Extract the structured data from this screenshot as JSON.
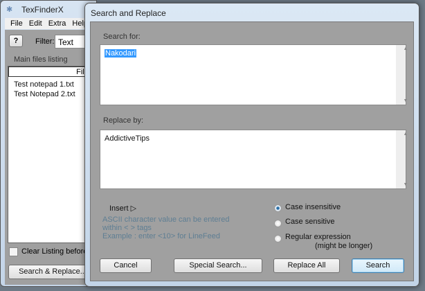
{
  "main_window": {
    "title": "TexFinderX",
    "menu": [
      "File",
      "Edit",
      "Extra",
      "Help"
    ],
    "help_button": "?",
    "filter_label": "Filter:",
    "filter_value": "Text",
    "listing_label": "Main files listing",
    "column_header": "File n",
    "files": [
      "Test notepad 1.txt",
      "Test Notepad 2.txt"
    ],
    "clear_listing_label": "Clear Listing before a",
    "clear_listing_checked": false,
    "search_replace_button": "Search & Replace..."
  },
  "dialog": {
    "title": "Search and Replace",
    "search_label": "Search for:",
    "search_value": "Nakodari",
    "replace_label": "Replace by:",
    "replace_value": "AddictiveTips",
    "insert_label": "Insert",
    "info_lines": [
      "ASCII character value can be entered",
      "within < > tags",
      "Example : enter <10> for LineFeed"
    ],
    "options": [
      {
        "label": "Case insensitive",
        "selected": true
      },
      {
        "label": "Case sensitive",
        "selected": false
      },
      {
        "label": "Regular expression",
        "selected": false
      }
    ],
    "regex_note": "(might be longer)",
    "buttons": {
      "cancel": "Cancel",
      "special": "Special Search...",
      "replace_all": "Replace All",
      "search": "Search"
    }
  }
}
